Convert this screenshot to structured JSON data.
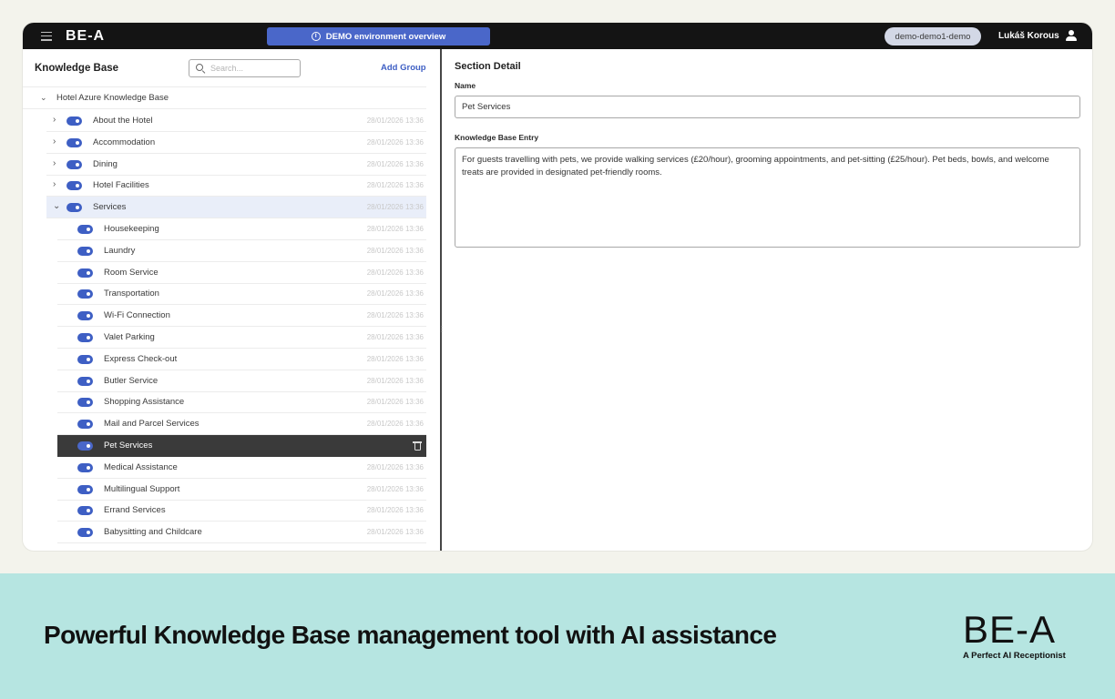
{
  "topbar": {
    "logo": "BE-A",
    "demo_banner": "DEMO environment overview",
    "environment": "demo-demo1-demo",
    "user": "Lukáš Korous"
  },
  "left": {
    "title": "Knowledge Base",
    "search_placeholder": "Search...",
    "add_group": "Add Group",
    "root": "Hotel Azure Knowledge Base"
  },
  "tree": [
    {
      "label": "About the Hotel",
      "date": "28/01/2026 13:36"
    },
    {
      "label": "Accommodation",
      "date": "28/01/2026 13:36"
    },
    {
      "label": "Dining",
      "date": "28/01/2026 13:36"
    },
    {
      "label": "Hotel Facilities",
      "date": "28/01/2026 13:36"
    },
    {
      "label": "Services",
      "date": "28/01/2026 13:36"
    },
    {
      "label": "Housekeeping",
      "date": "28/01/2026 13:36"
    },
    {
      "label": "Laundry",
      "date": "28/01/2026 13:36"
    },
    {
      "label": "Room Service",
      "date": "28/01/2026 13:36"
    },
    {
      "label": "Transportation",
      "date": "28/01/2026 13:36"
    },
    {
      "label": "Wi-Fi Connection",
      "date": "28/01/2026 13:36"
    },
    {
      "label": "Valet Parking",
      "date": "28/01/2026 13:36"
    },
    {
      "label": "Express Check-out",
      "date": "28/01/2026 13:36"
    },
    {
      "label": "Butler Service",
      "date": "28/01/2026 13:36"
    },
    {
      "label": "Shopping Assistance",
      "date": "28/01/2026 13:36"
    },
    {
      "label": "Mail and Parcel Services",
      "date": "28/01/2026 13:36"
    },
    {
      "label": "Pet Services",
      "date": ""
    },
    {
      "label": "Medical Assistance",
      "date": "28/01/2026 13:36"
    },
    {
      "label": "Multilingual Support",
      "date": "28/01/2026 13:36"
    },
    {
      "label": "Errand Services",
      "date": "28/01/2026 13:36"
    },
    {
      "label": "Babysitting and Childcare",
      "date": "28/01/2026 13:36"
    }
  ],
  "detail": {
    "title": "Section Detail",
    "name_label": "Name",
    "name_value": "Pet Services",
    "entry_label": "Knowledge Base Entry",
    "entry_value": "For guests travelling with pets, we provide walking services (£20/hour), grooming appointments, and pet-sitting (£25/hour). Pet beds, bowls, and welcome treats are provided in designated pet-friendly rooms."
  },
  "footer": {
    "tagline": "Powerful Knowledge Base management tool with AI assistance",
    "logo": "BE-A",
    "subtitle": "A Perfect AI Receptionist"
  },
  "colors": {
    "accent": "#3e5fc4",
    "topbar": "#141414",
    "band": "#b6e5e1",
    "selected": "#3a3a3a"
  }
}
